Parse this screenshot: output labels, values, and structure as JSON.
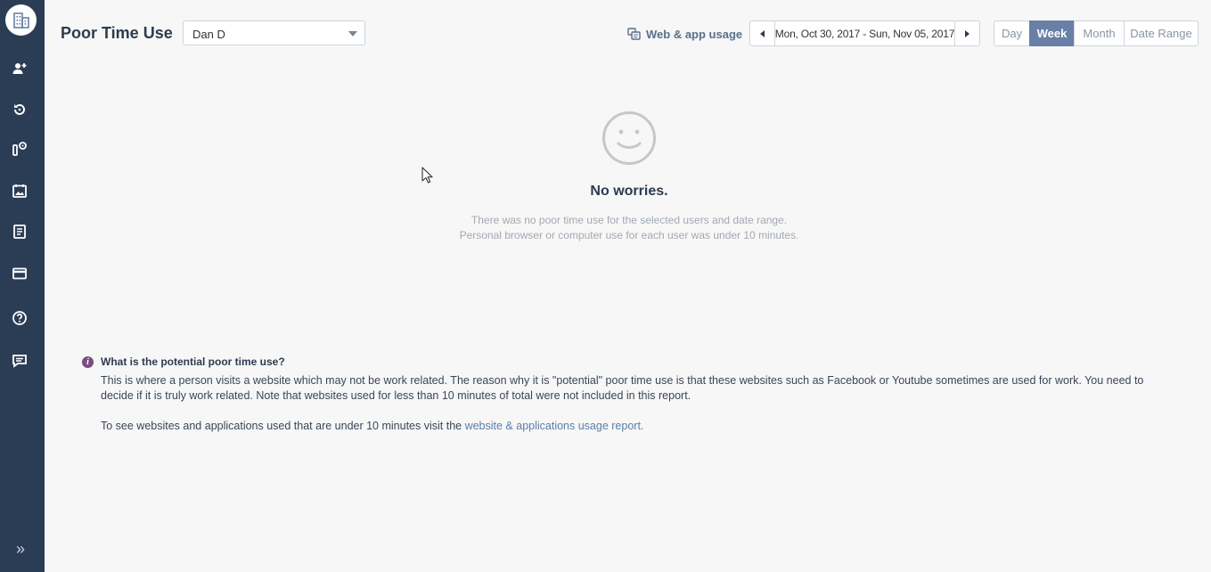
{
  "sidebar": {
    "logo_icon": "building-icon",
    "items": [
      {
        "name": "add-user",
        "icon": "add-user-icon"
      },
      {
        "name": "history",
        "icon": "refresh-icon"
      },
      {
        "name": "productivity",
        "icon": "speedometer-icon"
      },
      {
        "name": "calendar",
        "icon": "calendar-icon"
      },
      {
        "name": "reports",
        "icon": "document-icon"
      },
      {
        "name": "billing",
        "icon": "card-icon"
      },
      {
        "name": "help",
        "icon": "help-icon"
      },
      {
        "name": "chat",
        "icon": "chat-icon"
      }
    ],
    "expand_label": "»"
  },
  "header": {
    "title": "Poor Time Use",
    "user_select_value": "Dan D",
    "web_app_link": "Web & app usage",
    "date_range": "Mon, Oct 30, 2017 - Sun, Nov 05, 2017",
    "range_options": [
      "Day",
      "Week",
      "Month",
      "Date Range"
    ],
    "active_range": "Week"
  },
  "empty_state": {
    "icon": "smiley-icon",
    "title": "No worries.",
    "line1": "There was no poor time use for the selected users and date range.",
    "line2": "Personal browser or computer use for each user was under 10 minutes."
  },
  "info": {
    "title": "What is the potential poor time use?",
    "body": "This is where a person visits a website which may not be work related. The reason why it is \"potential\" poor time use is that these websites such as Facebook or Youtube sometimes are used for work. You need to decide if it is truly work related. Note that websites used for less than 10 minutes of total were not included in this report.",
    "more_prefix": "To see websites and applications used that are under 10 minutes visit the ",
    "more_link": "website & applications usage report."
  },
  "colors": {
    "sidebar_bg": "#2b3d55",
    "accent": "#6a7fa6",
    "info_icon": "#7a4e80",
    "link": "#5a7ea8"
  }
}
